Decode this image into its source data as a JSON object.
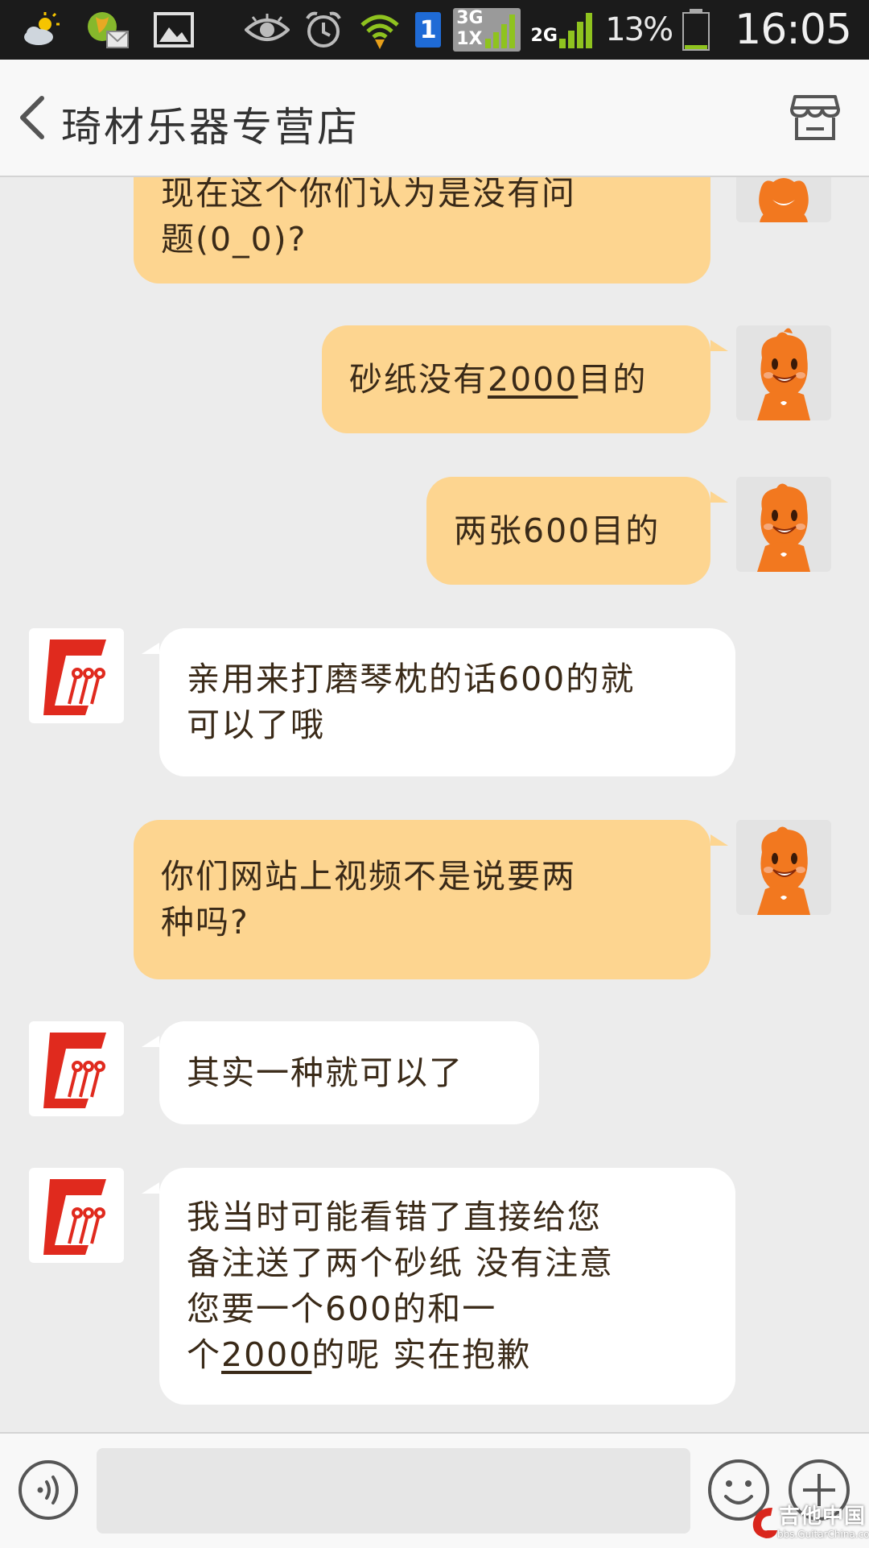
{
  "status_bar": {
    "battery_text": "13%",
    "time": "16:05",
    "network_3g": "3G",
    "network_1x": "1X",
    "network_2g": "2G",
    "sim_slot": "1",
    "icons": [
      "weather-icon",
      "email-icon",
      "gallery-icon",
      "eye-icon",
      "alarm-icon",
      "wifi-icon",
      "sim-icon",
      "signal-3g-icon",
      "signal-2g-icon",
      "battery-icon"
    ]
  },
  "header": {
    "title": "琦材乐器专营店",
    "back_icon": "chevron-left-icon",
    "shop_icon": "store-icon"
  },
  "messages": [
    {
      "side": "out",
      "lines": [
        "现在这个你们认为是没有问",
        "题(0_0)?"
      ]
    },
    {
      "side": "out",
      "lines": [
        "砂纸没有2000目的"
      ]
    },
    {
      "side": "out",
      "lines": [
        "两张600目的"
      ]
    },
    {
      "side": "in",
      "lines": [
        "亲用来打磨琴枕的话600的就",
        "可以了哦"
      ]
    },
    {
      "side": "out",
      "lines": [
        "你们网站上视频不是说要两",
        "种吗?"
      ]
    },
    {
      "side": "in",
      "lines": [
        "其实一种就可以了"
      ]
    },
    {
      "side": "in",
      "lines": [
        "我当时可能看错了直接给您",
        "备注送了两个砂纸 没有注意",
        "您要一个600的和一",
        "个2000的呢 实在抱歉"
      ]
    }
  ],
  "underlined_terms": [
    "2000"
  ],
  "input": {
    "value": "",
    "placeholder": ""
  },
  "watermark": {
    "text": "吉他中国",
    "url": "bbs.GuitarChina.com"
  },
  "colors": {
    "outgoing_bubble": "#fdd590",
    "incoming_bubble": "#ffffff",
    "chat_background": "#ececec",
    "shop_logo_red": "#e02a1e",
    "avatar_orange": "#f2781f"
  }
}
